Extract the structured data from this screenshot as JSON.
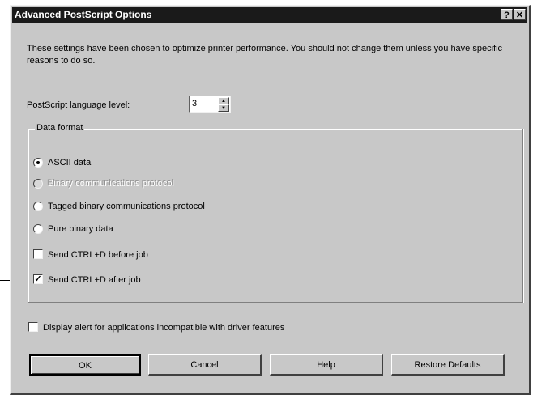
{
  "dialog": {
    "title": "Advanced PostScript Options",
    "help_glyph": "?",
    "close_glyph": "✕"
  },
  "intro_text": "These settings have been chosen to optimize printer performance. You should not change them unless you have specific reasons to do so.",
  "language_level": {
    "label": "PostScript language level:",
    "value": "3",
    "up_glyph": "▲",
    "down_glyph": "▼"
  },
  "data_format": {
    "title": "Data format",
    "options": [
      {
        "label": "ASCII data",
        "checked": true,
        "disabled": false
      },
      {
        "label": "Binary communications protocol",
        "checked": false,
        "disabled": true
      },
      {
        "label": "Tagged binary communications protocol",
        "checked": false,
        "disabled": false
      },
      {
        "label": "Pure binary data",
        "checked": false,
        "disabled": false
      }
    ],
    "checkboxes": [
      {
        "label": "Send CTRL+D before job",
        "checked": false
      },
      {
        "label": "Send CTRL+D after job",
        "checked": true
      }
    ]
  },
  "display_alert": {
    "label": "Display alert for applications incompatible with driver features",
    "checked": false
  },
  "buttons": {
    "ok": "OK",
    "cancel": "Cancel",
    "help": "Help",
    "restore": "Restore Defaults"
  },
  "check_glyph": "✓",
  "colors": {
    "title_bg": "#1a1a1a",
    "face": "#c8c8c8"
  }
}
